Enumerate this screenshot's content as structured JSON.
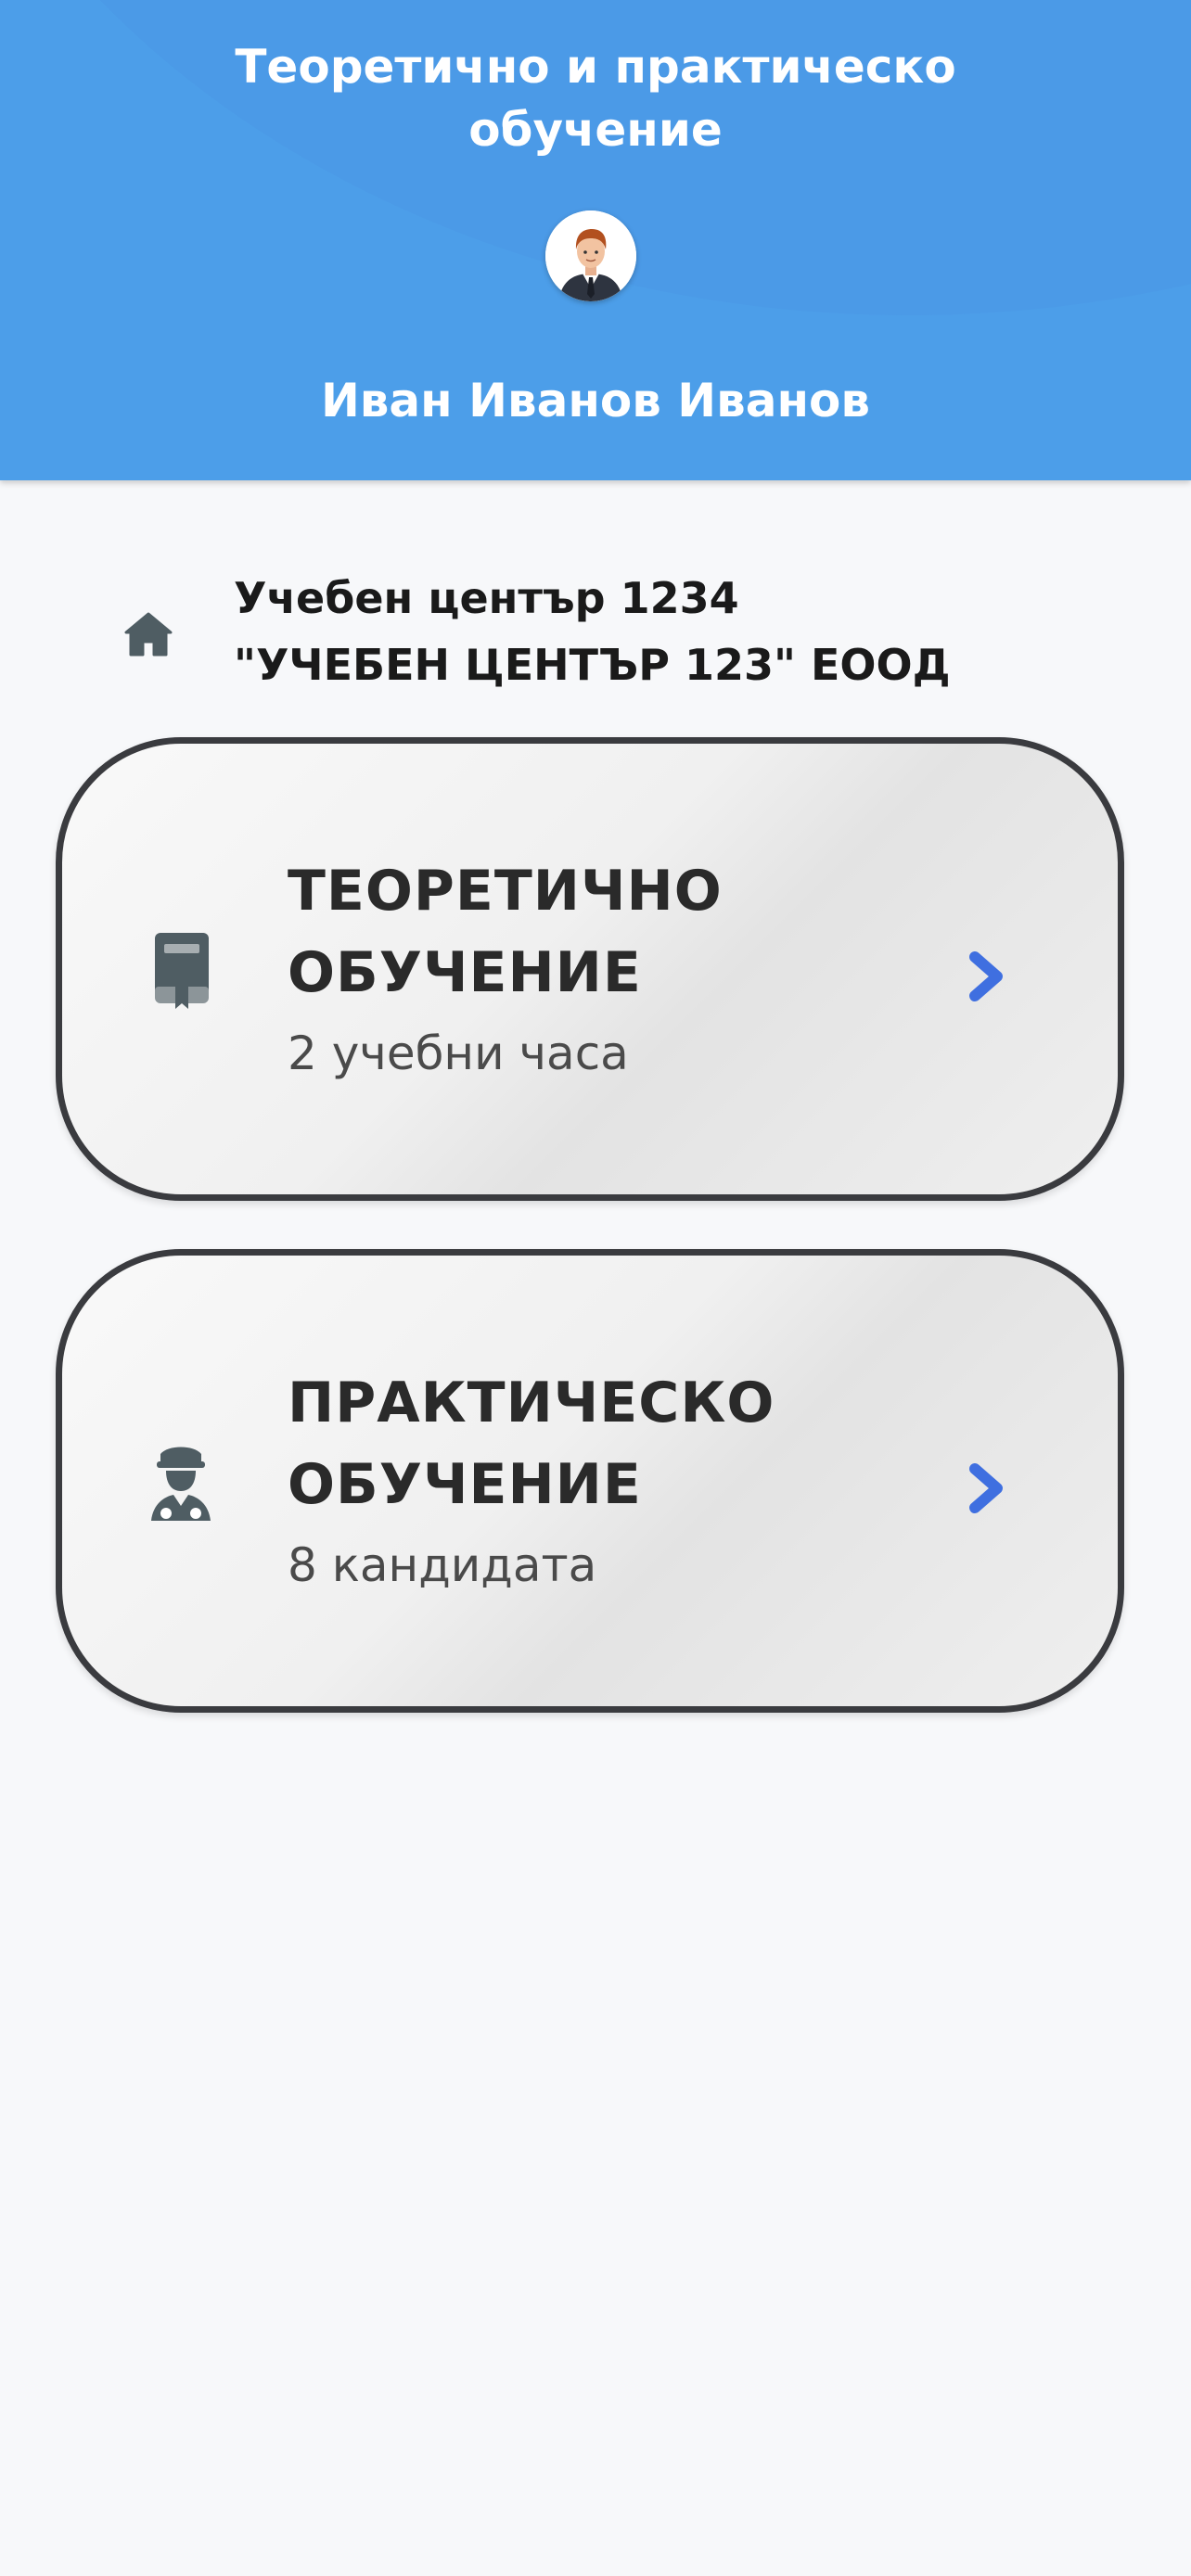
{
  "header": {
    "title": "Теоретично и практическо\nобучение",
    "user_name": "Иван Иванов Иванов",
    "avatar_icon": "user-avatar-icon",
    "background_color": "#4c9ee9"
  },
  "organization": {
    "icon": "home-icon",
    "line1": "Учебен център 1234",
    "line2": "\"УЧЕБЕН ЦЕНТЪР 123\" ЕООД"
  },
  "cards": [
    {
      "icon": "book-icon",
      "title": "ТЕОРЕТИЧНО\nОБУЧЕНИЕ",
      "subtitle": "2 учебни часа",
      "action_icon": "chevron-right-icon"
    },
    {
      "icon": "driver-icon",
      "title": "ПРАКТИЧЕСКО\nОБУЧЕНИЕ",
      "subtitle": "8 кандидата",
      "action_icon": "chevron-right-icon"
    }
  ],
  "colors": {
    "accent": "#3f6fe0",
    "icon_gray": "#4f5d63",
    "card_border": "#3a3b3f"
  }
}
